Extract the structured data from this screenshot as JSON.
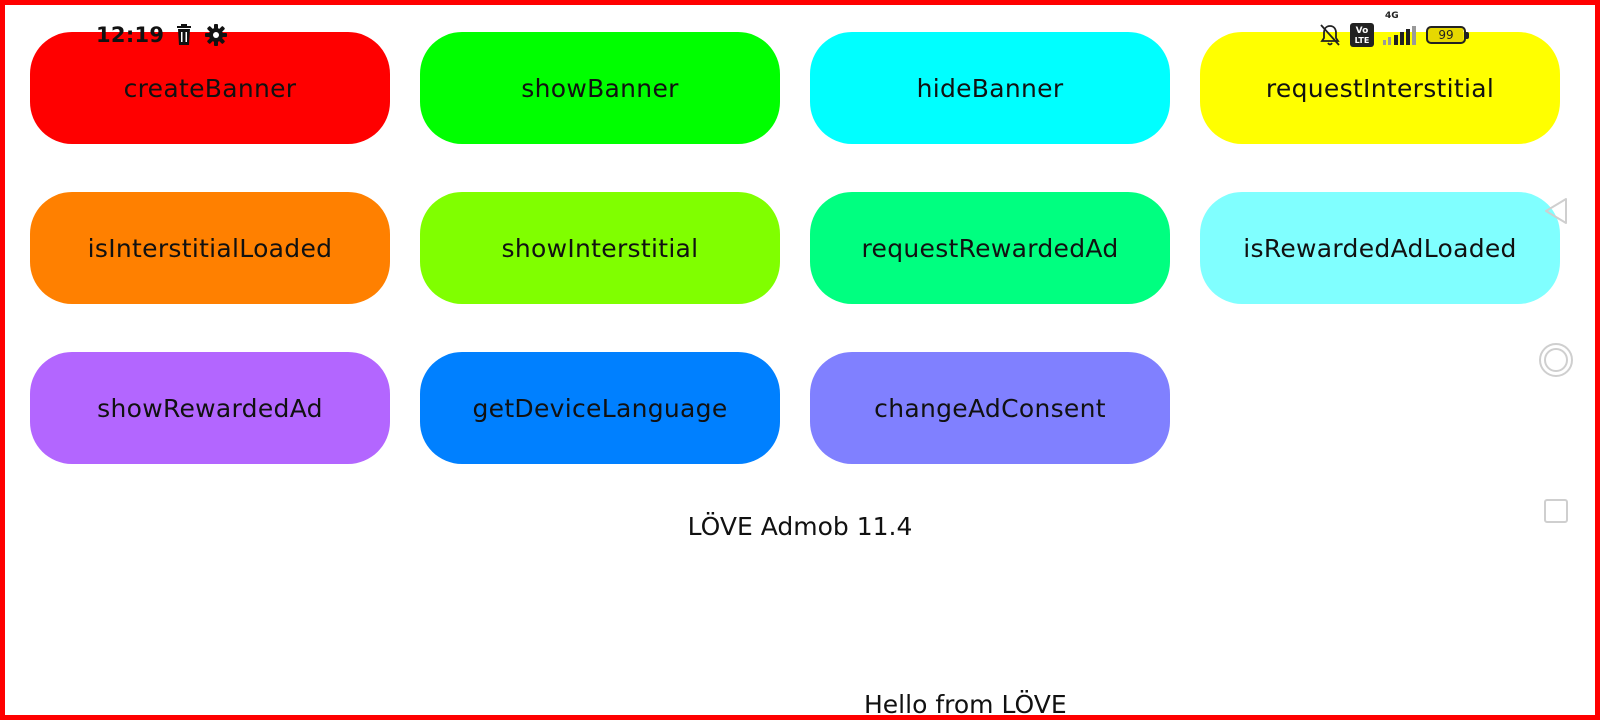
{
  "status_bar": {
    "time": "12:19",
    "left_icons": [
      "trash-icon",
      "gear-icon"
    ],
    "right_icons": [
      "bell-muted-icon",
      "volte-icon",
      "signal-icon",
      "battery-icon"
    ],
    "network": "4G",
    "volte_top": "Vo",
    "volte_bottom": "LTE",
    "battery_level": "99"
  },
  "buttons": [
    {
      "label": "createBanner",
      "color": "#ff0000"
    },
    {
      "label": "showBanner",
      "color": "#00ff00"
    },
    {
      "label": "hideBanner",
      "color": "#00ffff"
    },
    {
      "label": "requestInterstitial",
      "color": "#ffff00"
    },
    {
      "label": "isInterstitialLoaded",
      "color": "#ff8000"
    },
    {
      "label": "showInterstitial",
      "color": "#80ff00"
    },
    {
      "label": "requestRewardedAd",
      "color": "#00ff80"
    },
    {
      "label": "isRewardedAdLoaded",
      "color": "#80ffff"
    },
    {
      "label": "showRewardedAd",
      "color": "#b366ff"
    },
    {
      "label": "getDeviceLanguage",
      "color": "#0080ff"
    },
    {
      "label": "changeAdConsent",
      "color": "#8080ff"
    }
  ],
  "version_text": "LÖVE Admob 11.4",
  "hello_text": "Hello from LÖVE",
  "frame_color": "#ff0000",
  "nav_icons": [
    "back-icon",
    "home-icon",
    "recents-icon"
  ]
}
